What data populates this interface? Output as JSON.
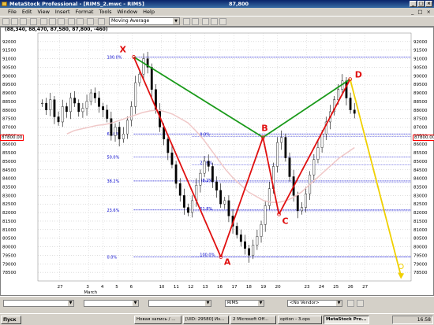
{
  "window": {
    "title": "MetaStock Professional - [RIMS_2.mwc - RIMS]",
    "center_value": "87,800"
  },
  "menu": [
    "File",
    "Edit",
    "View",
    "Insert",
    "Format",
    "Tools",
    "Window",
    "Help"
  ],
  "toolbar": {
    "indicator_select": "Moving Average"
  },
  "chart": {
    "header": "(88,340, 88,470, 87,580, 87,800, -460)",
    "left_price_box": "87800.00",
    "right_price_box": "87800.00"
  },
  "chart_data": {
    "type": "candlestick",
    "ylim": [
      78000,
      92500
    ],
    "y_ticks": [
      92000,
      91500,
      91000,
      90500,
      90000,
      89500,
      89000,
      88500,
      88000,
      87500,
      87000,
      86500,
      86000,
      85500,
      85000,
      84500,
      84000,
      83500,
      83000,
      82500,
      82000,
      81500,
      81000,
      80500,
      80000,
      79500,
      79000,
      78500
    ],
    "x_tick_labels": [
      "27",
      "3",
      "4",
      "5",
      "6",
      "10",
      "11",
      "12",
      "13",
      "16",
      "17",
      "18",
      "19",
      "20",
      "23",
      "24",
      "25",
      "26",
      "27"
    ],
    "x_tick_positions": [
      -1,
      1,
      2,
      3,
      4,
      6,
      7,
      8,
      9,
      10,
      11,
      12,
      13,
      14,
      16,
      17,
      18,
      19,
      20
    ],
    "month_label": "March",
    "harmonic_points": [
      {
        "label": "X",
        "x": 4.1,
        "y": 91100
      },
      {
        "label": "A",
        "x": 10.1,
        "y": 79400
      },
      {
        "label": "B",
        "x": 13.0,
        "y": 86400
      },
      {
        "label": "C",
        "x": 14.1,
        "y": 81900
      },
      {
        "label": "D",
        "x": 19.0,
        "y": 89800
      }
    ],
    "projection": {
      "from": {
        "x": 19.0,
        "y": 89800
      },
      "to": {
        "x": 22.5,
        "y": 78300
      }
    },
    "fib_levels": [
      {
        "label": "100.0%",
        "y": 91100
      },
      {
        "label": "61.8%",
        "y": 86600
      },
      {
        "label": "50.0%",
        "y": 85250
      },
      {
        "label": "38.2%",
        "y": 83850
      },
      {
        "label": "23.6%",
        "y": 82150
      },
      {
        "label": "0.0%",
        "y": 79400
      }
    ],
    "bc_levels": [
      {
        "label": "0.0%",
        "y": 86450
      },
      {
        "label": "23.6%",
        "y": 84790
      },
      {
        "label": "38.2%",
        "y": 83760
      },
      {
        "label": "61.8%",
        "y": 82100
      },
      {
        "label": "100.0%",
        "y": 79400
      }
    ],
    "close_series": [
      88400,
      88000,
      88600,
      87600,
      87300,
      88200,
      87900,
      88700,
      88400,
      87900,
      88100,
      88500,
      89000,
      88700,
      88200,
      88000,
      87500,
      86500,
      87000,
      86300,
      86600,
      87400,
      88200,
      89600,
      90100,
      91000,
      90500,
      89200,
      88000,
      87000,
      86300,
      85500,
      84800,
      83700,
      83000,
      82300,
      82000,
      82700,
      83600,
      84300,
      85000,
      84700,
      83800,
      83300,
      82500,
      82700,
      81800,
      81200,
      80700,
      80300,
      79900,
      79500,
      80100,
      80600,
      81300,
      82400,
      83400,
      84700,
      86100,
      86400,
      85200,
      84100,
      83000,
      82100,
      82300,
      83100,
      84200,
      85100,
      85800,
      86600,
      87300,
      87900,
      88600,
      89200,
      89700,
      88700,
      88000,
      87800
    ],
    "ma_series": [
      86600,
      86800,
      86900,
      87000,
      87100,
      87150,
      87250,
      87400,
      87550,
      87700,
      87850,
      87950,
      88000,
      87900,
      87750,
      87500,
      87250,
      86800,
      86300,
      85700,
      85100,
      84500,
      84000,
      83600,
      83200,
      82950,
      82700,
      82600,
      82600,
      82700,
      82900,
      83200,
      83600,
      84000,
      84400,
      84800,
      85200,
      85500,
      85800
    ]
  },
  "bottom": {
    "symbol_combo": "RIMS",
    "vendor_combo": "<No Vendor>"
  },
  "taskbar": {
    "start": "Пуск",
    "tasks": [
      "Новая запись / ...",
      "[UID: 29580] Из...",
      "2 Microsoft Off...",
      "option - 3.ops",
      "MetaStock Pro..."
    ],
    "clock": "16:58"
  },
  "colors": {
    "green_leg": "#1a9a1a",
    "red_leg": "#e01010",
    "yellow_projection": "#f0d000",
    "fib_line": "#0000cc",
    "label": "#e01010"
  }
}
